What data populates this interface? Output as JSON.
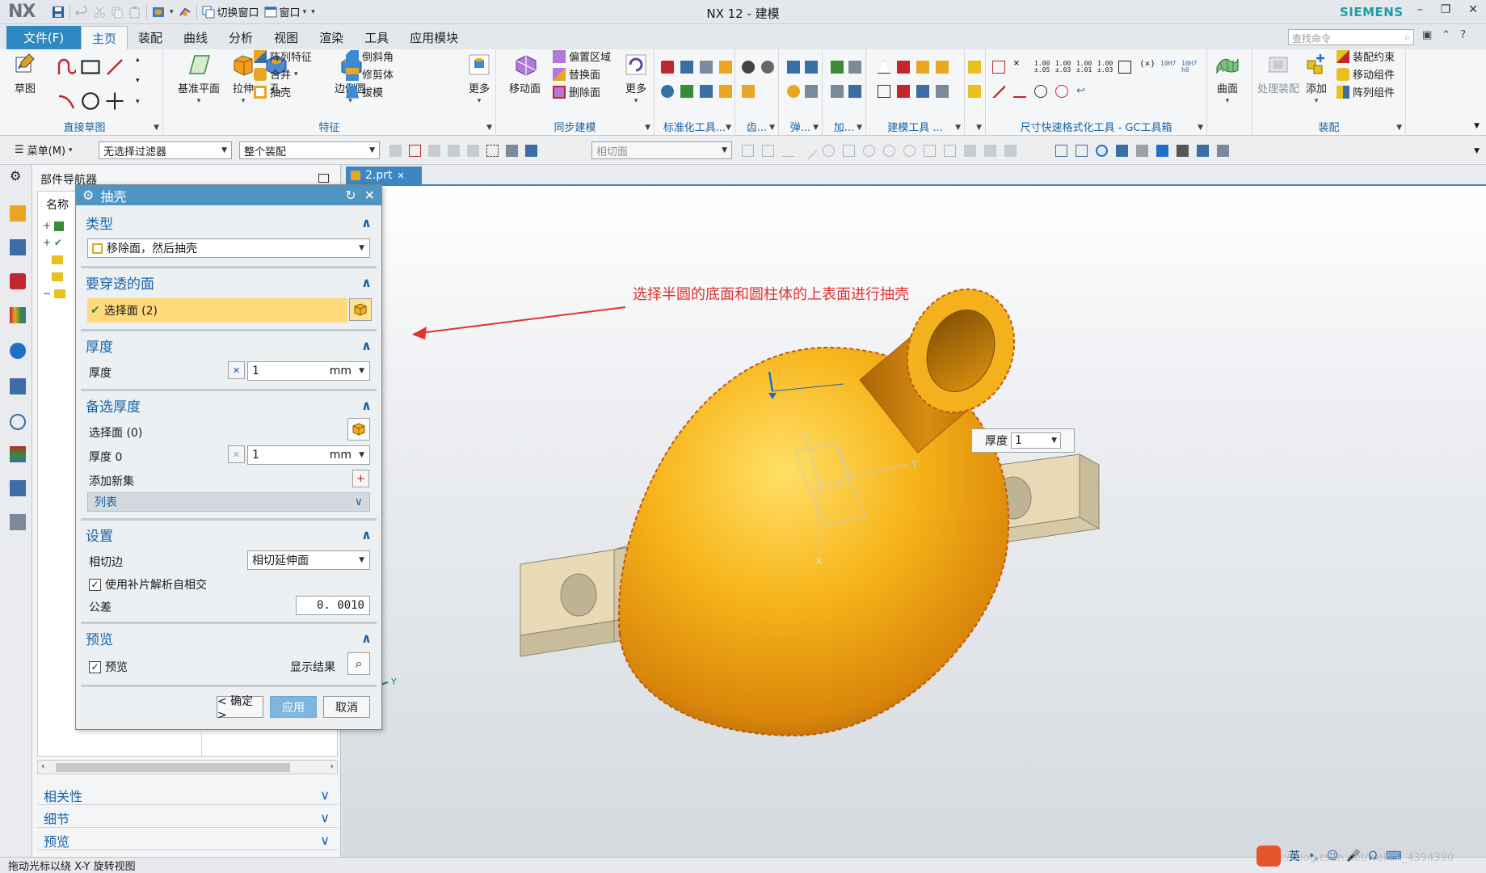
{
  "app": {
    "logo": "NX",
    "title": "NX 12 - 建模",
    "brand": "SIEMENS",
    "switch_window": "切换窗口",
    "window_menu": "窗口",
    "colors": {
      "accent": "#2e89c2",
      "brand": "#1a9fa5",
      "part": "#f5a10a",
      "annotation": "#e0322f"
    }
  },
  "menu_tabs": {
    "file": "文件(F)",
    "items": [
      "主页",
      "装配",
      "曲线",
      "分析",
      "视图",
      "渲染",
      "工具",
      "应用模块"
    ],
    "active": "主页",
    "search_placeholder": "查找命令"
  },
  "ribbon": {
    "groups": {
      "sketch": {
        "big": "草图",
        "name": "直接草图"
      },
      "feature": {
        "name": "特征",
        "datum": "基准平面",
        "extrude": "拉伸",
        "hole": "孔",
        "pattern": "阵列特征",
        "unite": "合并",
        "shell": "抽壳",
        "edge_blend": "边倒圆",
        "chamfer": "倒斜角",
        "trim_body": "修剪体",
        "draft": "拔模",
        "more": "更多"
      },
      "sync": {
        "name": "同步建模",
        "move_face": "移动面",
        "offset_region": "偏置区域",
        "replace_face": "替换面",
        "delete_face": "删除面",
        "more": "更多"
      },
      "std_tools": {
        "name": "标准化工具..."
      },
      "gear": {
        "name": "齿..."
      },
      "spring": {
        "name": "弹..."
      },
      "add": {
        "name": "加..."
      },
      "model_tools": {
        "name": "建模工具 ..."
      },
      "dim_tools": {
        "name": "尺寸快速格式化工具 - GC工具箱"
      },
      "surface": {
        "big": "曲面"
      },
      "assembly": {
        "name": "装配",
        "process": "处理装配",
        "add": "添加",
        "constraint": "装配约束",
        "move_comp": "移动组件",
        "pattern_comp": "阵列组件"
      }
    }
  },
  "selection_bar": {
    "menu": "菜单(M)",
    "filter": "无选择过滤器",
    "scope": "整个装配",
    "face_rule": "相切面"
  },
  "navigator": {
    "title": "部件导航器",
    "column": "名称",
    "sections": [
      "相关性",
      "细节",
      "预览"
    ]
  },
  "dialog": {
    "title": "抽壳",
    "type": {
      "header": "类型",
      "value": "移除面，然后抽壳"
    },
    "pierce": {
      "header": "要穿透的面",
      "select": "选择面 (2)"
    },
    "thickness": {
      "header": "厚度",
      "label": "厚度",
      "value": "1",
      "unit": "mm"
    },
    "alt_thickness": {
      "header": "备选厚度",
      "select": "选择面 (0)",
      "label": "厚度 0",
      "value": "1",
      "unit": "mm",
      "add_set": "添加新集",
      "list": "列表"
    },
    "settings": {
      "header": "设置",
      "tangent_label": "相切边",
      "tangent_value": "相切延伸面",
      "patch_label": "使用补片解析自相交",
      "tolerance_label": "公差",
      "tolerance_value": "0. 0010"
    },
    "preview": {
      "header": "预览",
      "check": "预览",
      "show_result": "显示结果"
    },
    "buttons": {
      "ok": "< 确定 >",
      "apply": "应用",
      "cancel": "取消"
    }
  },
  "graphics": {
    "tab": "2.prt",
    "annotation": "选择半圆的底面和圆柱体的上表面进行抽壳",
    "onscreen_label": "厚度",
    "onscreen_value": "1",
    "axes": {
      "x": "X",
      "y": "Y",
      "z": "Z"
    }
  },
  "status": {
    "text": "拖动光标以绕 X-Y 旋转视图",
    "ime": "英",
    "watermark": "https://blog.csdn.net/weixin_4394390"
  }
}
